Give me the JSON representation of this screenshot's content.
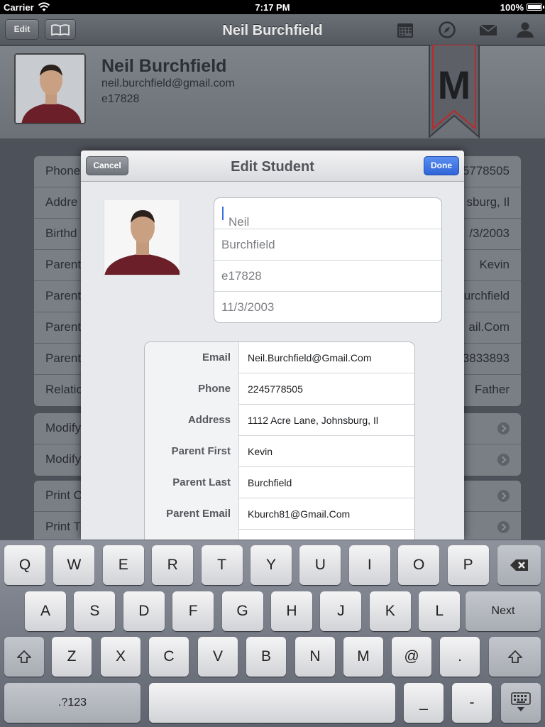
{
  "status": {
    "carrier": "Carrier",
    "time": "7:17 PM",
    "battery": "100%",
    "battery_level": 1.0
  },
  "navbar": {
    "edit_label": "Edit",
    "title": "Neil Burchfield",
    "icons": [
      "book-icon",
      "calendar-icon",
      "compass-icon",
      "mail-icon",
      "person-icon"
    ]
  },
  "header": {
    "name": "Neil Burchfield",
    "email": "neil.burchfield@gmail.com",
    "student_id": "e17828",
    "ribbon_letter": "M"
  },
  "background_list": {
    "info_rows": [
      {
        "label": "Phone",
        "value": "5778505"
      },
      {
        "label": "Addre",
        "value": "sburg, Il"
      },
      {
        "label": "Birthd",
        "value": "/3/2003"
      },
      {
        "label": "Parent",
        "value": "Kevin"
      },
      {
        "label": "Parent",
        "value": "urchfield"
      },
      {
        "label": "Parent",
        "value": "ail.Com"
      },
      {
        "label": "Parent",
        "value": "3833893"
      },
      {
        "label": "Relatio",
        "value": "Father"
      }
    ],
    "modify_rows": [
      "Modify",
      "Modify"
    ],
    "print_rows": [
      "Print C",
      "Print T"
    ]
  },
  "modal": {
    "title": "Edit Student",
    "cancel_label": "Cancel",
    "done_label": "Done",
    "name_fields": {
      "first": "Neil",
      "last": "Burchfield",
      "id": "e17828",
      "birthday": "11/3/2003"
    },
    "info": [
      {
        "label": "Email",
        "value": "Neil.Burchfield@Gmail.Com"
      },
      {
        "label": "Phone",
        "value": "2245778505"
      },
      {
        "label": "Address",
        "value": "1112 Acre Lane, Johnsburg, Il"
      },
      {
        "label": "Parent First",
        "value": "Kevin"
      },
      {
        "label": "Parent Last",
        "value": "Burchfield"
      },
      {
        "label": "Parent Email",
        "value": "Kburch81@Gmail.Com"
      },
      {
        "label": "",
        "value": ""
      }
    ]
  },
  "keyboard": {
    "row1": [
      "Q",
      "W",
      "E",
      "R",
      "T",
      "Y",
      "U",
      "I",
      "O",
      "P"
    ],
    "row2": [
      "A",
      "S",
      "D",
      "F",
      "G",
      "H",
      "J",
      "K",
      "L"
    ],
    "row3": [
      "Z",
      "X",
      "C",
      "V",
      "B",
      "N",
      "M",
      "@",
      "."
    ],
    "next_label": "Next",
    "numbers_label": ".?123",
    "underscore": "_",
    "dash": "-"
  },
  "colors": {
    "done_blue": "#2f64d8",
    "caret": "#3b6fe0",
    "ribbon_red": "#c0282a"
  }
}
